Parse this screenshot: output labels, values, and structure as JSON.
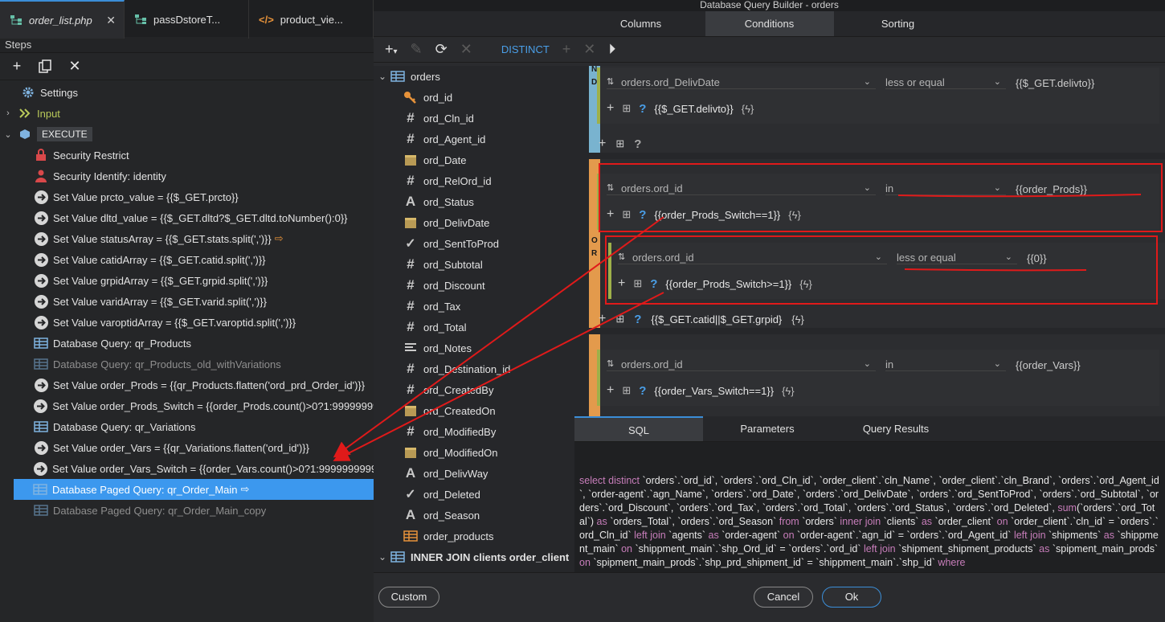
{
  "top_tabs": [
    {
      "label": "order_list.php",
      "active": true,
      "icon": "tree-icon"
    },
    {
      "label": "passDstoreT...",
      "active": false,
      "icon": "tree-icon"
    },
    {
      "label": "product_vie...",
      "active": false,
      "icon": "code-icon"
    }
  ],
  "steps_title": "Steps",
  "steps": [
    {
      "label": "Settings",
      "icon": "gear-icon",
      "indent": 1,
      "dim": false
    },
    {
      "label": "Input",
      "icon": "chevrons-icon",
      "indent": 0,
      "expandable": "collapsed",
      "dim": false,
      "color": "#b9c95a"
    },
    {
      "label": "EXECUTE",
      "icon": "cube-icon",
      "indent": 0,
      "expandable": "expanded",
      "badge": true
    },
    {
      "label": "Security Restrict",
      "icon": "lock-icon",
      "indent": 2
    },
    {
      "label": "Security Identify: identity",
      "icon": "user-icon",
      "indent": 2
    },
    {
      "label": "Set Value prcto_value = {{$_GET.prcto}}",
      "icon": "arrow-circle-icon",
      "indent": 2
    },
    {
      "label": "Set Value dltd_value = {{$_GET.dltd?$_GET.dltd.toNumber():0}}",
      "icon": "arrow-circle-icon",
      "indent": 2
    },
    {
      "label": "Set Value statusArray = {{$_GET.stats.split(',')}}",
      "icon": "arrow-circle-icon",
      "indent": 2,
      "output": true
    },
    {
      "label": "Set Value catidArray = {{$_GET.catid.split(',')}}",
      "icon": "arrow-circle-icon",
      "indent": 2
    },
    {
      "label": "Set Value grpidArray = {{$_GET.grpid.split(',')}}",
      "icon": "arrow-circle-icon",
      "indent": 2
    },
    {
      "label": "Set Value varidArray = {{$_GET.varid.split(',')}}",
      "icon": "arrow-circle-icon",
      "indent": 2
    },
    {
      "label": "Set Value varoptidArray = {{$_GET.varoptid.split(',')}}",
      "icon": "arrow-circle-icon",
      "indent": 2
    },
    {
      "label": "Database Query: qr_Products",
      "icon": "table-icon",
      "indent": 2
    },
    {
      "label": "Database Query: qr_Products_old_withVariations",
      "icon": "table-icon",
      "indent": 2,
      "dim": true
    },
    {
      "label": "Set Value order_Prods = {{qr_Products.flatten('ord_prd_Order_id')}}",
      "icon": "arrow-circle-icon",
      "indent": 2
    },
    {
      "label": "Set Value order_Prods_Switch = {{order_Prods.count()>0?1:999999999",
      "icon": "arrow-circle-icon",
      "indent": 2
    },
    {
      "label": "Database Query: qr_Variations",
      "icon": "table-icon",
      "indent": 2
    },
    {
      "label": "Set Value order_Vars = {{qr_Variations.flatten('ord_id')}}",
      "icon": "arrow-circle-icon",
      "indent": 2
    },
    {
      "label": "Set Value order_Vars_Switch = {{order_Vars.count()>0?1:99999999999}}",
      "icon": "arrow-circle-icon",
      "indent": 2
    },
    {
      "label": "Database Paged Query: qr_Order_Main",
      "icon": "table-icon",
      "indent": 2,
      "selected": true,
      "output": true
    },
    {
      "label": "Database Paged Query: qr_Order_Main_copy",
      "icon": "table-icon",
      "indent": 2,
      "dim": true
    }
  ],
  "dialog_title": "Database Query Builder - orders",
  "dialog_tabs": [
    {
      "label": "Columns",
      "active": false
    },
    {
      "label": "Conditions",
      "active": true
    },
    {
      "label": "Sorting",
      "active": false
    }
  ],
  "distinct_label": "DISTINCT",
  "fields": [
    {
      "label": "orders",
      "icon": "table-icon",
      "top": true,
      "bold": false
    },
    {
      "label": "ord_id",
      "icon": "key-icon"
    },
    {
      "label": "ord_Cln_id",
      "icon": "hash-icon"
    },
    {
      "label": "ord_Agent_id",
      "icon": "hash-icon"
    },
    {
      "label": "ord_Date",
      "icon": "calendar-icon"
    },
    {
      "label": "ord_RelOrd_id",
      "icon": "hash-icon"
    },
    {
      "label": "ord_Status",
      "icon": "text-icon"
    },
    {
      "label": "ord_DelivDate",
      "icon": "calendar-icon"
    },
    {
      "label": "ord_SentToProd",
      "icon": "check-icon"
    },
    {
      "label": "ord_Subtotal",
      "icon": "hash-icon"
    },
    {
      "label": "ord_Discount",
      "icon": "hash-icon"
    },
    {
      "label": "ord_Tax",
      "icon": "hash-icon"
    },
    {
      "label": "ord_Total",
      "icon": "hash-icon"
    },
    {
      "label": "ord_Notes",
      "icon": "lines-icon"
    },
    {
      "label": "ord_Destination_id",
      "icon": "hash-icon"
    },
    {
      "label": "ord_CreatedBy",
      "icon": "hash-icon"
    },
    {
      "label": "ord_CreatedOn",
      "icon": "calendar-icon"
    },
    {
      "label": "ord_ModifiedBy",
      "icon": "hash-icon"
    },
    {
      "label": "ord_ModifiedOn",
      "icon": "calendar-icon"
    },
    {
      "label": "ord_DelivWay",
      "icon": "text-icon"
    },
    {
      "label": "ord_Deleted",
      "icon": "check-icon"
    },
    {
      "label": "ord_Season",
      "icon": "text-icon"
    },
    {
      "label": "order_products",
      "icon": "table-orange-icon"
    },
    {
      "label": "INNER JOIN clients order_client",
      "icon": "table-icon",
      "top": true,
      "bold": true
    }
  ],
  "groups": [
    {
      "letter": "N\nD",
      "color": "#79b3cf"
    },
    {
      "letter": "O\nR",
      "color": "#e39a4c"
    },
    {
      "letter": "",
      "color": "#e39a4c"
    }
  ],
  "conditions": [
    {
      "field": "orders.ord_DelivDate",
      "op": "less or equal",
      "value": "{{$_GET.delivto}}",
      "cond": "{{$_GET.delivto}}"
    },
    {
      "field": "orders.ord_id",
      "op": "in",
      "value": "{{order_Prods}}",
      "cond": "{{order_Prods_Switch==1}}"
    },
    {
      "field": "orders.ord_id",
      "op": "less or equal",
      "value": "{{0}}",
      "cond": "{{order_Prods_Switch>=1}}"
    },
    {
      "field": "orders.ord_id",
      "op": "in",
      "value": "{{order_Vars}}",
      "cond": "{{order_Vars_Switch==1}}"
    }
  ],
  "group_cond": "{{$_GET.catid||$_GET.grpid}",
  "sql_tabs": [
    {
      "label": "SQL",
      "active": true
    },
    {
      "label": "Parameters",
      "active": false
    },
    {
      "label": "Query Results",
      "active": false
    }
  ],
  "sql_parts": [
    {
      "t": "select distinct",
      "kw": true
    },
    {
      "t": " `orders`.`ord_id`, `orders`.`ord_Cln_id`, `order_client`.`cln_Name`, `order_client`.`cln_Brand`, `orders`.`ord_Agent_id`, `order-agent`.`agn_Name`, `orders`.`ord_Date`, `orders`.`ord_DelivDate`, `orders`.`ord_SentToProd`, `orders`.`ord_Subtotal`, `orders`.`ord_Discount`, `orders`.`ord_Tax`, `orders`.`ord_Total`, `orders`.`ord_Status`, `orders`.`ord_Deleted`, "
    },
    {
      "t": "sum",
      "kw": true
    },
    {
      "t": "(`orders`.`ord_Total`) ",
      "kw": false
    },
    {
      "t": "as",
      "kw": true
    },
    {
      "t": " `orders_Total`, `orders`.`ord_Season` ",
      "kw": false
    },
    {
      "t": "from",
      "kw": true
    },
    {
      "t": " `orders` ",
      "kw": false
    },
    {
      "t": "inner join",
      "kw": true
    },
    {
      "t": " `clients` ",
      "kw": false
    },
    {
      "t": "as",
      "kw": true
    },
    {
      "t": " `order_client` ",
      "kw": false
    },
    {
      "t": "on",
      "kw": true
    },
    {
      "t": " `order_client`.`cln_id` = `orders`.`ord_Cln_id` ",
      "kw": false
    },
    {
      "t": "left join",
      "kw": true
    },
    {
      "t": " `agents` ",
      "kw": false
    },
    {
      "t": "as",
      "kw": true
    },
    {
      "t": " `order-agent` ",
      "kw": false
    },
    {
      "t": "on",
      "kw": true
    },
    {
      "t": " `order-agent`.`agn_id` = `orders`.`ord_Agent_id` ",
      "kw": false
    },
    {
      "t": "left join",
      "kw": true
    },
    {
      "t": " `shipments` ",
      "kw": false
    },
    {
      "t": "as",
      "kw": true
    },
    {
      "t": " `shippment_main` ",
      "kw": false
    },
    {
      "t": "on",
      "kw": true
    },
    {
      "t": " `shippment_main`.`shp_Ord_id` = `orders`.`ord_id` ",
      "kw": false
    },
    {
      "t": "left join",
      "kw": true
    },
    {
      "t": " `shipment_shipment_products` ",
      "kw": false
    },
    {
      "t": "as",
      "kw": true
    },
    {
      "t": " `spipment_main_prods` ",
      "kw": false
    },
    {
      "t": "on",
      "kw": true
    },
    {
      "t": " `spipment_main_prods`.`shp_prd_shipment_id` = `shippment_main`.`shp_id` ",
      "kw": false
    },
    {
      "t": "where",
      "kw": true
    }
  ],
  "buttons": {
    "custom": "Custom",
    "cancel": "Cancel",
    "ok": "Ok"
  },
  "colors": {
    "accent": "#3b8ed8",
    "selected": "#3c98ee",
    "annotation": "#e01a1a",
    "keyword": "#c77dba"
  }
}
